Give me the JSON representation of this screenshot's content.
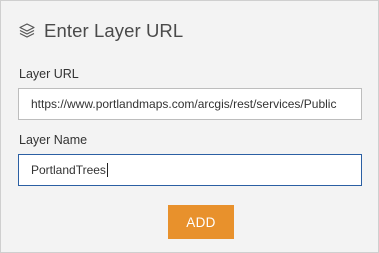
{
  "header": {
    "icon": "layers-icon",
    "title": "Enter Layer URL"
  },
  "form": {
    "url_label": "Layer URL",
    "url_value": "https://www.portlandmaps.com/arcgis/rest/services/Public",
    "name_label": "Layer Name",
    "name_value": "PortlandTrees"
  },
  "actions": {
    "add_label": "ADD"
  },
  "colors": {
    "panel_background": "#f3f3f3",
    "add_button": "#e8912c",
    "focused_border": "#2b5fa3"
  }
}
